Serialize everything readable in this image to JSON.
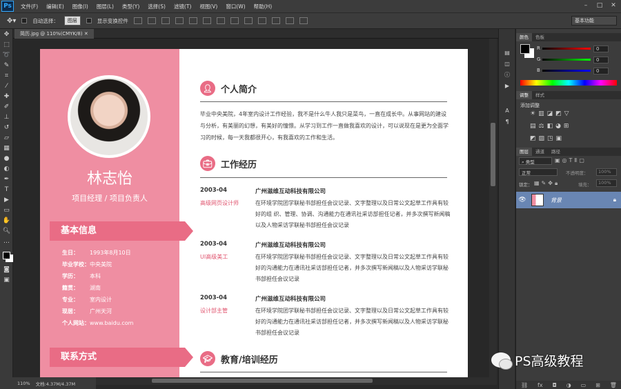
{
  "app": {
    "logo": "Ps"
  },
  "menu": [
    "文件(F)",
    "编辑(E)",
    "图像(I)",
    "图层(L)",
    "类型(Y)",
    "选择(S)",
    "滤镜(T)",
    "视图(V)",
    "窗口(W)",
    "帮助(H)"
  ],
  "options": {
    "auto_select_label": "自动选择：",
    "auto_select_value": "图层",
    "show_transform_label": "显示变换控件",
    "workspace": "基本功能"
  },
  "document_tab": {
    "label": "简历.jpg @ 110%(CMYK/8)"
  },
  "status": {
    "zoom": "110%",
    "doc_size": "文档:4.37M/4.37M"
  },
  "resume": {
    "name": "林志怡",
    "role": "项目经理 / 项目负责人",
    "basic_info_title": "基本信息",
    "contact_title": "联系方式",
    "info": [
      {
        "label": "生日：",
        "value": "1993年8月10日"
      },
      {
        "label": "毕业学校：",
        "value": "中央美院"
      },
      {
        "label": "学历：",
        "value": "本科"
      },
      {
        "label": "籍贯：",
        "value": "湖南"
      },
      {
        "label": "专业：",
        "value": "室内设计"
      },
      {
        "label": "现居：",
        "value": "广州天河"
      },
      {
        "label": "个人网站：",
        "value": "www.baidu.com"
      }
    ],
    "intro_title": "个人简介",
    "intro_text": "毕业中央美院，4年室内设计工作经验，我不是什么牛人我只是菜鸟，一直在成长中。从事网站的建设与分析，有美丽的幻想，有美好的憧憬。从学习到工作一直做我喜欢的设计，可以说现在是更为全面学习的时候，每一天我都很开心，有我喜欢的工作和生活。",
    "work_title": "工作经历",
    "jobs": [
      {
        "date": "2003-04",
        "title": "高级网页设计师",
        "company": "广州滋维互动科技有限公司",
        "desc": "在环境学院团学联秘书部担任会议记录、文字整理以及日常公文起草工作具有较好的组 织、管理、协调、沟通能力在通讯社采访部担任记者，并多次撰写新闻稿以及人物采访学联秘书部担任会议记录"
      },
      {
        "date": "2003-04",
        "title": "UI高级美工",
        "company": "广州滋维互动科技有限公司",
        "desc": "在环境学院团学联秘书部担任会议记录、文字整理以及日常公文起草工作具有较好的沟通能力在通讯社采访部担任记者，并多次撰写新闻稿以及人物采访学联秘书部担任会议记录"
      },
      {
        "date": "2003-04",
        "title": "设计部主管",
        "company": "广州滋维互动科技有限公司",
        "desc": "在环境学院团学联秘书部担任会议记录、文字整理以及日常公文起草工作具有较好的沟通能力在通讯社采访部担任记者，并多次撰写新闻稿以及人物采访学联秘书部担任会议记录"
      }
    ],
    "edu_title": "教育/培训经历"
  },
  "panels": {
    "color_tabs": [
      "颜色",
      "色板"
    ],
    "channels": [
      {
        "label": "R",
        "value": "0"
      },
      {
        "label": "G",
        "value": "0"
      },
      {
        "label": "B",
        "value": "0"
      }
    ],
    "adjust_tabs": [
      "调整",
      "样式"
    ],
    "adjust_title": "添加调整",
    "layer_tabs": [
      "图层",
      "通道",
      "路径"
    ],
    "layer_filter": "类型",
    "blend_mode": "正常",
    "opacity_label": "不透明度：",
    "opacity": "100%",
    "lock_label": "锁定：",
    "fill_label": "填充：",
    "fill": "100%",
    "layer_name": "背景"
  },
  "watermark": "PS高级教程",
  "colors": {
    "accent": "#ef8ea2",
    "header": "#e96c85",
    "layer_selected": "#6986b3"
  }
}
